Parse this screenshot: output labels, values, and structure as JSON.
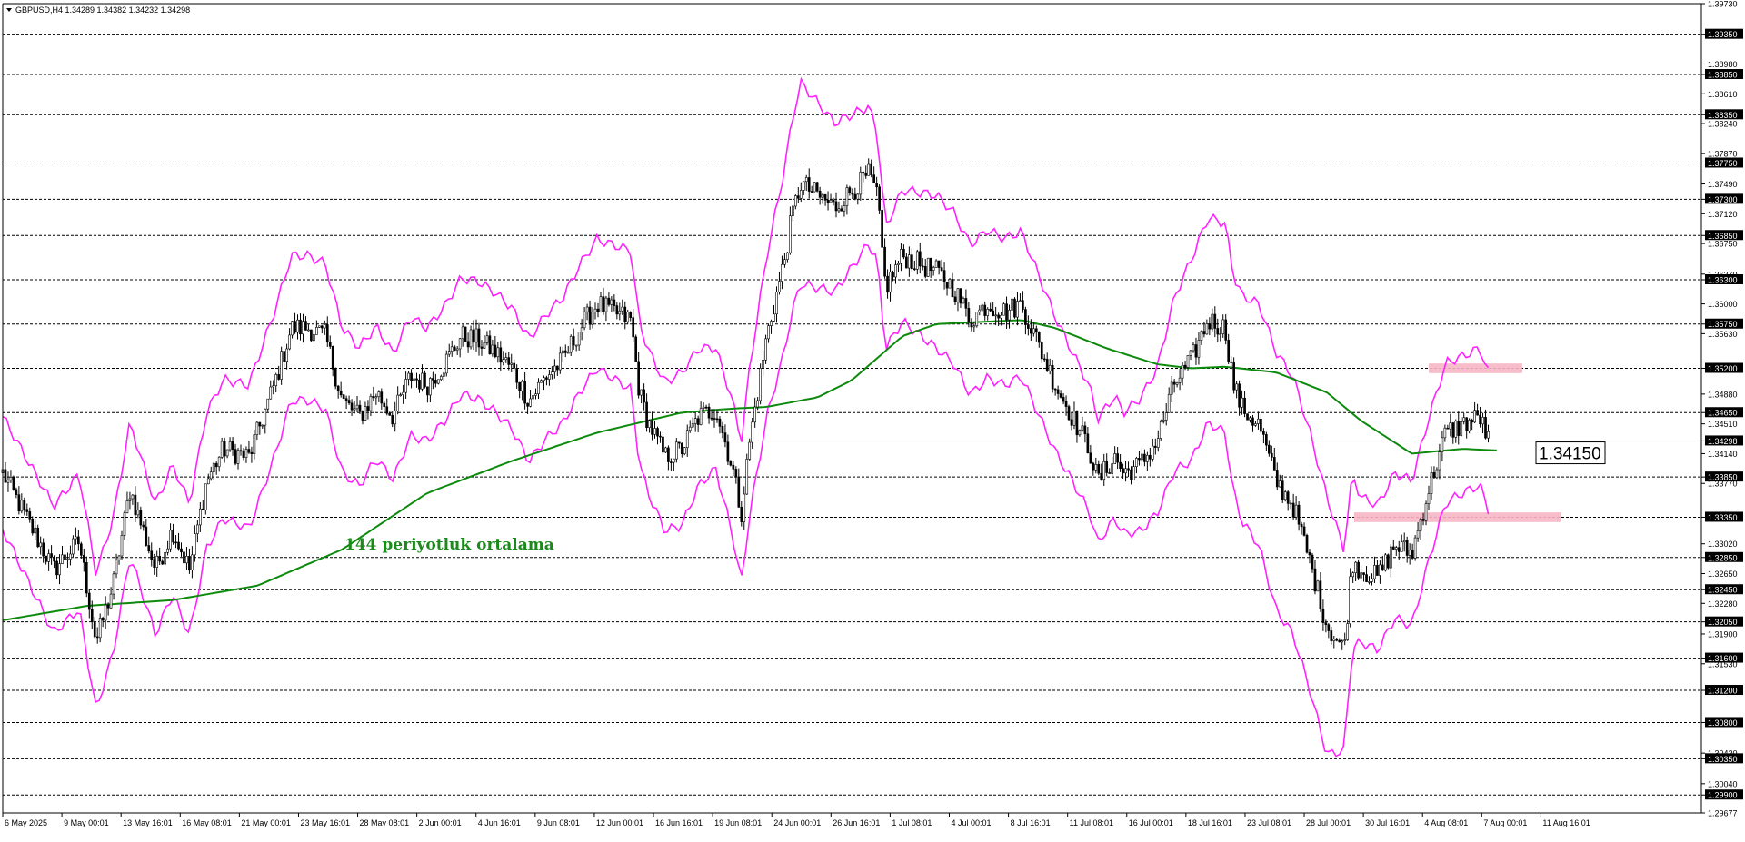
{
  "header": {
    "symbol_line": "GBPUSD,H4  1.34289 1.34382 1.34232 1.34298",
    "dropdown_icon": "triangle-down-icon"
  },
  "annotation": {
    "text": "144 periyotluk ortalama",
    "color": "#1b8a1b"
  },
  "price_label": {
    "value": "1.34150",
    "price": 1.3415
  },
  "colors": {
    "candle": "#000000",
    "bollinger": "#ff22ff",
    "ma144": "#0d8a0d",
    "zone": "#f6b6c4",
    "level_line": "#000000",
    "level_label_bg": "#000000",
    "current_price_line": "#b4b4b4"
  },
  "chart_data": {
    "type": "candlestick",
    "symbol": "GBPUSD",
    "timeframe": "H4",
    "ylim": [
      1.29677,
      1.3973
    ],
    "x_labels": [
      "6 May 2025",
      "9 May 00:01",
      "13 May 16:01",
      "16 May 08:01",
      "21 May 00:01",
      "23 May 16:01",
      "28 May 08:01",
      "2 Jun 00:01",
      "4 Jun 16:01",
      "9 Jun 08:01",
      "12 Jun 00:01",
      "16 Jun 16:01",
      "19 Jun 08:01",
      "24 Jun 00:01",
      "26 Jun 16:01",
      "1 Jul 08:01",
      "4 Jul 00:01",
      "8 Jul 16:01",
      "11 Jul 08:01",
      "16 Jul 00:01",
      "18 Jul 16:01",
      "23 Jul 08:01",
      "28 Jul 00:01",
      "30 Jul 16:01",
      "4 Aug 08:01",
      "7 Aug 00:01",
      "11 Aug 16:01"
    ],
    "y_ticks": [
      "1.39730",
      "1.39350",
      "1.38980",
      "1.38850",
      "1.38610",
      "1.38350",
      "1.38240",
      "1.37870",
      "1.37750",
      "1.37490",
      "1.37300",
      "1.37120",
      "1.36850",
      "1.36750",
      "1.36370",
      "1.36300",
      "1.36000",
      "1.35750",
      "1.35630",
      "1.35200",
      "1.34880",
      "1.34650",
      "1.34510",
      "1.34298",
      "1.34140",
      "1.33850",
      "1.33770",
      "1.33350",
      "1.33020",
      "1.32850",
      "1.32650",
      "1.32450",
      "1.32280",
      "1.32050",
      "1.31900",
      "1.31600",
      "1.31530",
      "1.31200",
      "1.30800",
      "1.30420",
      "1.30350",
      "1.30040",
      "1.29900",
      "1.29677"
    ],
    "levels": [
      "1.39350",
      "1.38850",
      "1.38350",
      "1.37750",
      "1.37300",
      "1.36850",
      "1.36300",
      "1.35750",
      "1.35200",
      "1.34650",
      "1.33850",
      "1.33350",
      "1.32850",
      "1.32450",
      "1.32050",
      "1.31600",
      "1.31200",
      "1.30800",
      "1.30350",
      "1.29900"
    ],
    "current_price": "1.34298",
    "zones": [
      {
        "x_from": 1.3518,
        "label": "",
        "y_from": 1.3514,
        "y_to": 1.3526,
        "t_from": 0.84,
        "t_to": 0.895
      },
      {
        "x_from": 1.333,
        "label": "",
        "y_from": 1.3329,
        "y_to": 1.3341,
        "t_from": 0.796,
        "t_to": 0.918
      }
    ],
    "ma_anchors": [
      [
        0,
        1.3207
      ],
      [
        0.05,
        1.3225
      ],
      [
        0.1,
        1.3232
      ],
      [
        0.15,
        1.325
      ],
      [
        0.2,
        1.3295
      ],
      [
        0.25,
        1.3365
      ],
      [
        0.3,
        1.3405
      ],
      [
        0.35,
        1.344
      ],
      [
        0.4,
        1.3465
      ],
      [
        0.43,
        1.347
      ],
      [
        0.45,
        1.3472
      ],
      [
        0.48,
        1.3484
      ],
      [
        0.5,
        1.3505
      ],
      [
        0.53,
        1.356
      ],
      [
        0.55,
        1.3575
      ],
      [
        0.6,
        1.358
      ],
      [
        0.62,
        1.357
      ],
      [
        0.65,
        1.3545
      ],
      [
        0.68,
        1.3525
      ],
      [
        0.7,
        1.352
      ],
      [
        0.72,
        1.3522
      ],
      [
        0.75,
        1.3515
      ],
      [
        0.78,
        1.349
      ],
      [
        0.8,
        1.3455
      ],
      [
        0.83,
        1.3414
      ],
      [
        0.86,
        1.342
      ],
      [
        0.88,
        1.3418
      ]
    ],
    "price_anchors": [
      [
        0,
        1.339
      ],
      [
        0.015,
        1.333
      ],
      [
        0.03,
        1.327
      ],
      [
        0.045,
        1.3305
      ],
      [
        0.055,
        1.318
      ],
      [
        0.065,
        1.325
      ],
      [
        0.075,
        1.337
      ],
      [
        0.09,
        1.327
      ],
      [
        0.1,
        1.332
      ],
      [
        0.11,
        1.327
      ],
      [
        0.12,
        1.338
      ],
      [
        0.13,
        1.342
      ],
      [
        0.145,
        1.341
      ],
      [
        0.16,
        1.35
      ],
      [
        0.17,
        1.357
      ],
      [
        0.18,
        1.357
      ],
      [
        0.19,
        1.356
      ],
      [
        0.2,
        1.348
      ],
      [
        0.21,
        1.346
      ],
      [
        0.22,
        1.349
      ],
      [
        0.23,
        1.346
      ],
      [
        0.24,
        1.351
      ],
      [
        0.25,
        1.35
      ],
      [
        0.26,
        1.3525
      ],
      [
        0.27,
        1.356
      ],
      [
        0.28,
        1.3555
      ],
      [
        0.29,
        1.354
      ],
      [
        0.3,
        1.352
      ],
      [
        0.31,
        1.348
      ],
      [
        0.32,
        1.351
      ],
      [
        0.33,
        1.353
      ],
      [
        0.34,
        1.357
      ],
      [
        0.35,
        1.36
      ],
      [
        0.36,
        1.359
      ],
      [
        0.37,
        1.358
      ],
      [
        0.375,
        1.349
      ],
      [
        0.38,
        1.3455
      ],
      [
        0.39,
        1.341
      ],
      [
        0.4,
        1.342
      ],
      [
        0.41,
        1.346
      ],
      [
        0.42,
        1.347
      ],
      [
        0.43,
        1.3395
      ],
      [
        0.435,
        1.334
      ],
      [
        0.44,
        1.343
      ],
      [
        0.45,
        1.356
      ],
      [
        0.46,
        1.365
      ],
      [
        0.465,
        1.371
      ],
      [
        0.47,
        1.375
      ],
      [
        0.48,
        1.3735
      ],
      [
        0.49,
        1.372
      ],
      [
        0.5,
        1.374
      ],
      [
        0.51,
        1.376
      ],
      [
        0.515,
        1.3735
      ],
      [
        0.52,
        1.362
      ],
      [
        0.53,
        1.366
      ],
      [
        0.54,
        1.365
      ],
      [
        0.55,
        1.364
      ],
      [
        0.56,
        1.362
      ],
      [
        0.57,
        1.358
      ],
      [
        0.58,
        1.36
      ],
      [
        0.59,
        1.359
      ],
      [
        0.6,
        1.36
      ],
      [
        0.61,
        1.355
      ],
      [
        0.62,
        1.35
      ],
      [
        0.63,
        1.346
      ],
      [
        0.64,
        1.342
      ],
      [
        0.645,
        1.338
      ],
      [
        0.655,
        1.341
      ],
      [
        0.66,
        1.339
      ],
      [
        0.67,
        1.34
      ],
      [
        0.68,
        1.343
      ],
      [
        0.69,
        1.35
      ],
      [
        0.7,
        1.353
      ],
      [
        0.71,
        1.358
      ],
      [
        0.72,
        1.357
      ],
      [
        0.725,
        1.35
      ],
      [
        0.73,
        1.347
      ],
      [
        0.74,
        1.345
      ],
      [
        0.75,
        1.338
      ],
      [
        0.76,
        1.335
      ],
      [
        0.77,
        1.328
      ],
      [
        0.78,
        1.32
      ],
      [
        0.79,
        1.317
      ],
      [
        0.795,
        1.328
      ],
      [
        0.8,
        1.327
      ],
      [
        0.81,
        1.326
      ],
      [
        0.82,
        1.33
      ],
      [
        0.83,
        1.329
      ],
      [
        0.84,
        1.337
      ],
      [
        0.85,
        1.344
      ],
      [
        0.86,
        1.345
      ],
      [
        0.87,
        1.346
      ],
      [
        0.875,
        1.343
      ]
    ],
    "bb_width_anchors": [
      [
        0,
        0.007
      ],
      [
        0.05,
        0.0085
      ],
      [
        0.1,
        0.008
      ],
      [
        0.15,
        0.009
      ],
      [
        0.2,
        0.009
      ],
      [
        0.25,
        0.007
      ],
      [
        0.3,
        0.0075
      ],
      [
        0.35,
        0.008
      ],
      [
        0.4,
        0.0095
      ],
      [
        0.42,
        0.0075
      ],
      [
        0.45,
        0.01
      ],
      [
        0.47,
        0.0125
      ],
      [
        0.5,
        0.0095
      ],
      [
        0.52,
        0.0075
      ],
      [
        0.55,
        0.0095
      ],
      [
        0.6,
        0.009
      ],
      [
        0.63,
        0.008
      ],
      [
        0.66,
        0.0075
      ],
      [
        0.68,
        0.009
      ],
      [
        0.7,
        0.0125
      ],
      [
        0.72,
        0.013
      ],
      [
        0.75,
        0.016
      ],
      [
        0.78,
        0.016
      ],
      [
        0.8,
        0.009
      ],
      [
        0.83,
        0.009
      ],
      [
        0.86,
        0.0085
      ],
      [
        0.875,
        0.0085
      ]
    ],
    "n_candles": 550
  }
}
